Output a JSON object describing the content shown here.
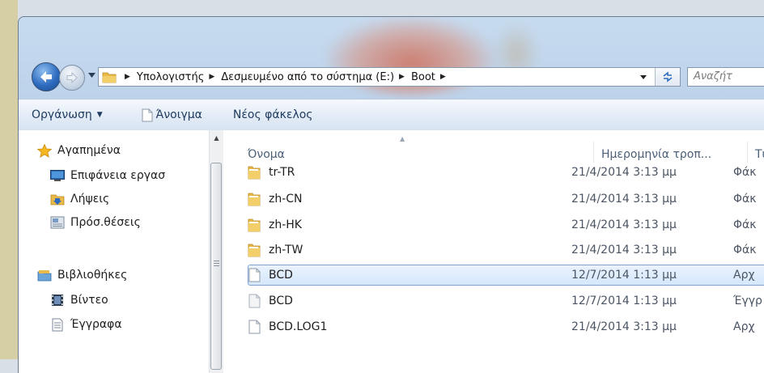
{
  "address": {
    "crumbs": [
      "Υπολογιστής",
      "Δεσμευμένο από το σύστημα (E:)",
      "Boot"
    ]
  },
  "search": {
    "placeholder": "Αναζήτ"
  },
  "toolbar": {
    "organize_label": "Οργάνωση",
    "open_label": "Άνοιγμα",
    "new_folder_label": "Νέος φάκελος"
  },
  "nav": {
    "favorites_label": "Αγαπημένα",
    "desktop_label": "Επιφάνεια εργασ",
    "downloads_label": "Λήψεις",
    "recent_label": "Πρόσ.θέσεις",
    "libraries_label": "Βιβλιοθήκες",
    "videos_label": "Βίντεο",
    "documents_label": "Έγγραφα"
  },
  "columns": {
    "name": "Όνομα",
    "date": "Ημερομηνία τροπ...",
    "type": "Τύπ"
  },
  "files": [
    {
      "name": "tr-TR",
      "date": "21/4/2014 3:13 μμ",
      "type": "Φάκ",
      "icon": "folder-icon"
    },
    {
      "name": "zh-CN",
      "date": "21/4/2014 3:13 μμ",
      "type": "Φάκ",
      "icon": "folder-icon"
    },
    {
      "name": "zh-HK",
      "date": "21/4/2014 3:13 μμ",
      "type": "Φάκ",
      "icon": "folder-icon"
    },
    {
      "name": "zh-TW",
      "date": "21/4/2014 3:13 μμ",
      "type": "Φάκ",
      "icon": "folder-icon"
    },
    {
      "name": "BCD",
      "date": "12/7/2014 1:13 μμ",
      "type": "Αρχ",
      "icon": "file-icon",
      "selected": true
    },
    {
      "name": "BCD",
      "date": "12/7/2014 1:13 μμ",
      "type": "Έγγρ",
      "icon": "file-icon"
    },
    {
      "name": "BCD.LOG1",
      "date": "21/4/2014 3:13 μμ",
      "type": "Αρχ",
      "icon": "file-icon"
    }
  ],
  "colors": {
    "selection": "#cce4fb",
    "selection_border": "#7da2ce",
    "toolbar_text": "#1e3a5f"
  }
}
